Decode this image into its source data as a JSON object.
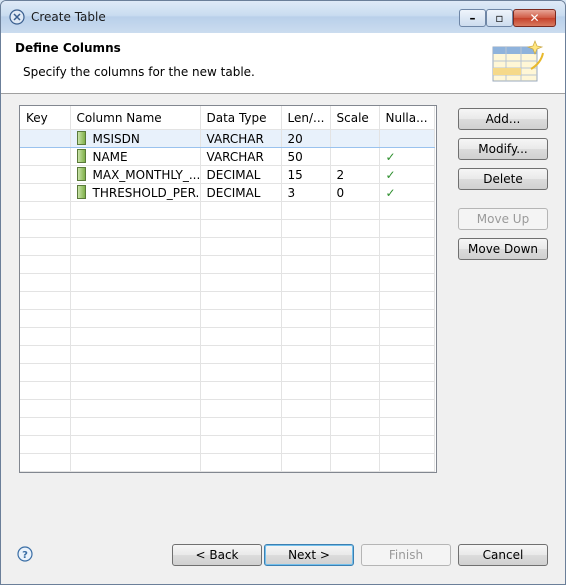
{
  "window": {
    "title": "Create Table",
    "min_label": "–",
    "max_label": "▫",
    "close_label": "✕"
  },
  "header": {
    "title": "Define Columns",
    "description": "Specify the columns for the new table."
  },
  "table": {
    "columns": [
      "Key",
      "Column Name",
      "Data Type",
      "Len/...",
      "Scale",
      "Nulla..."
    ],
    "rows": [
      {
        "key": "",
        "name": "MSISDN",
        "type": "VARCHAR",
        "len": "20",
        "scale": "",
        "nullable": ""
      },
      {
        "key": "",
        "name": "NAME",
        "type": "VARCHAR",
        "len": "50",
        "scale": "",
        "nullable": "✓"
      },
      {
        "key": "",
        "name": "MAX_MONTHLY_...",
        "type": "DECIMAL",
        "len": "15",
        "scale": "2",
        "nullable": "✓"
      },
      {
        "key": "",
        "name": "THRESHOLD_PER...",
        "type": "DECIMAL",
        "len": "3",
        "scale": "0",
        "nullable": "✓"
      }
    ],
    "selected_row": 0
  },
  "side_buttons": {
    "add": "Add...",
    "modify": "Modify...",
    "delete": "Delete",
    "move_up": "Move Up",
    "move_down": "Move Down"
  },
  "footer": {
    "back": "< Back",
    "next": "Next >",
    "finish": "Finish",
    "cancel": "Cancel"
  },
  "icons": {
    "title": "eclipse-icon",
    "wizard": "table-wizard-icon",
    "help": "help-icon",
    "column": "column-icon",
    "check": "check-icon"
  }
}
